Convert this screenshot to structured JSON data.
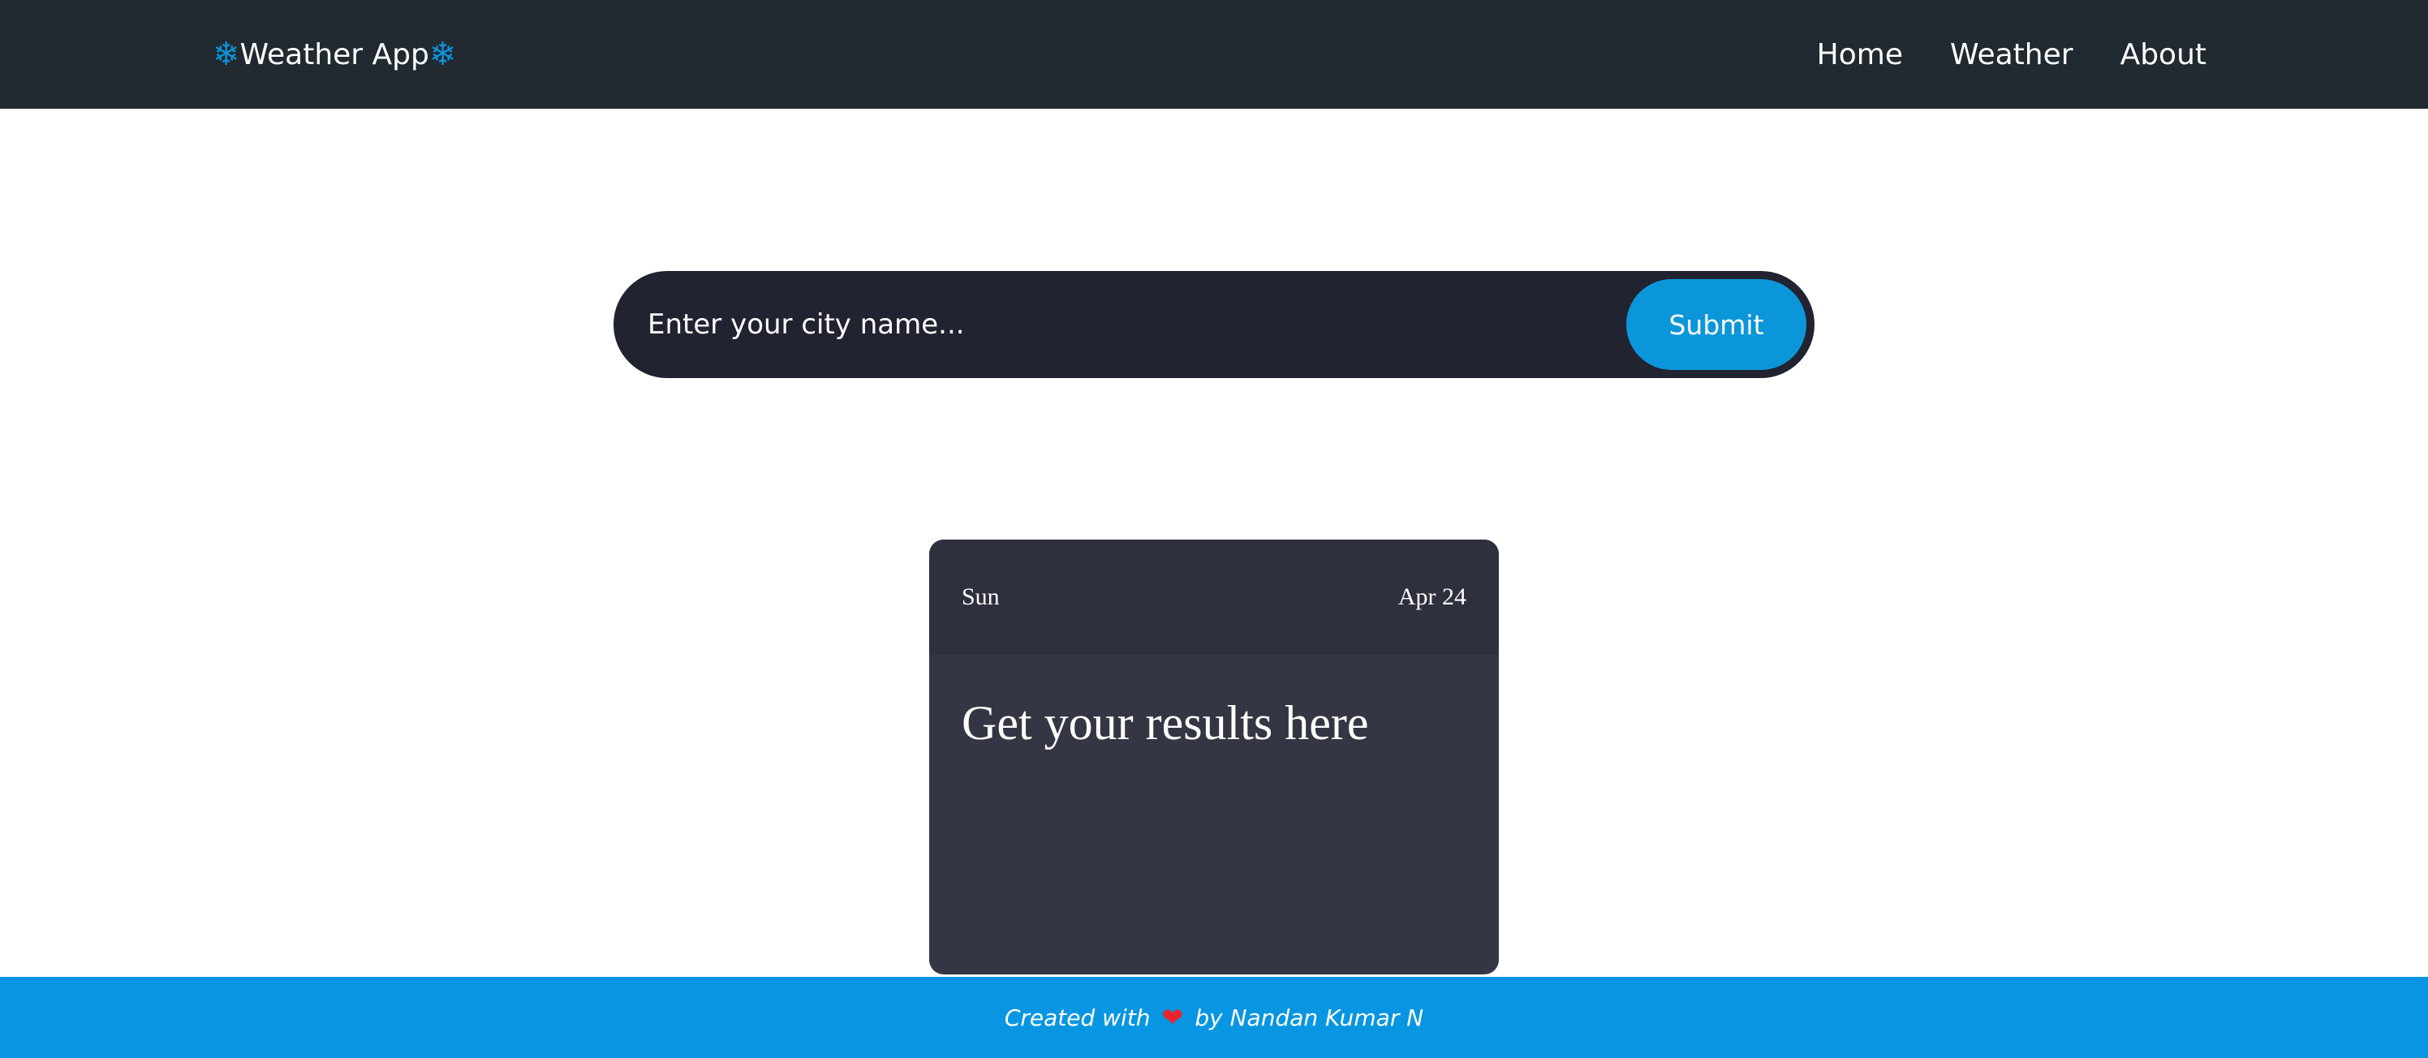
{
  "navbar": {
    "brand_icon": "❄",
    "brand_text": "Weather App",
    "links": [
      "Home",
      "Weather",
      "About"
    ]
  },
  "search": {
    "placeholder": "Enter your city name...",
    "submit_label": "Submit"
  },
  "card": {
    "day": "Sun",
    "date": "Apr 24",
    "title": "Get your results here"
  },
  "footer": {
    "prefix": "Created with",
    "heart_icon": "❤",
    "suffix": "by Nandan Kumar N"
  },
  "colors": {
    "navbar_bg": "#212931",
    "accent": "#0b96d9",
    "search_bg": "#212331",
    "card_bg": "#343644",
    "footer_bg": "#0896e3",
    "heart": "#e8262c"
  }
}
